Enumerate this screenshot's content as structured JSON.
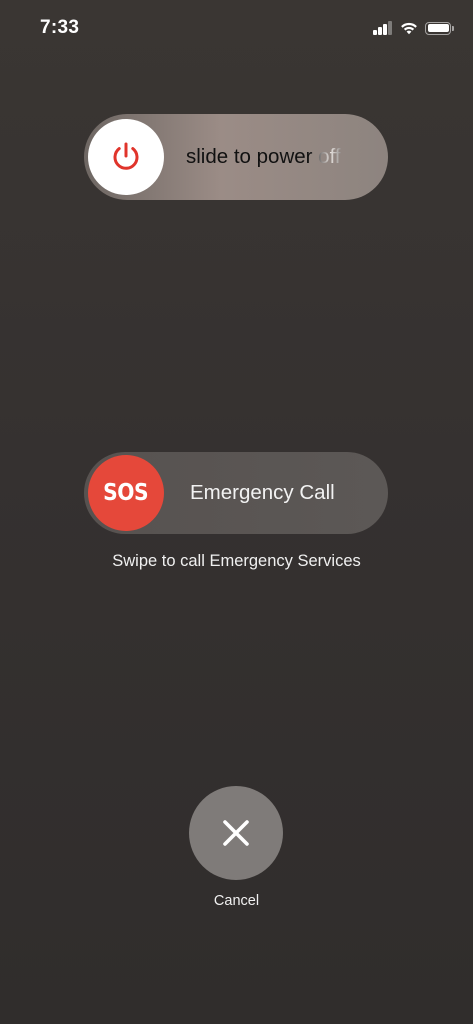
{
  "status_bar": {
    "time": "7:33",
    "signal_icon": "cellular-signal-icon",
    "wifi_icon": "wifi-icon",
    "battery_icon": "battery-icon",
    "signal_bars_active": 3,
    "signal_bars_total": 4,
    "battery_level": 1.0
  },
  "power_slider": {
    "label": "slide to power off",
    "icon": "power-icon",
    "icon_color": "#e0342b"
  },
  "sos_slider": {
    "knob_label": "SOS",
    "label": "Emergency Call",
    "knob_color": "#e5483a"
  },
  "sos_hint": "Swipe to call Emergency Services",
  "cancel": {
    "icon": "close-icon",
    "label": "Cancel"
  }
}
